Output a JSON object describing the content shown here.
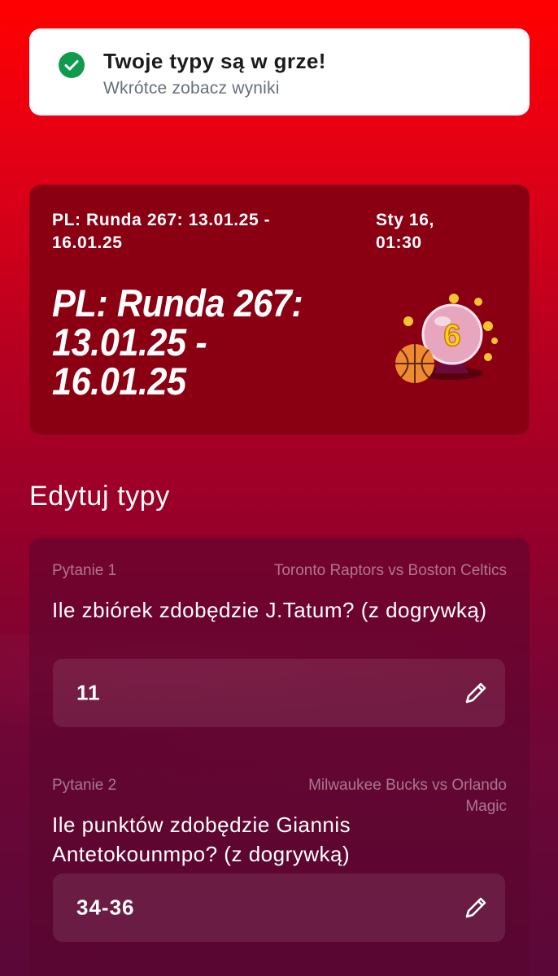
{
  "toast": {
    "icon": "check-circle-icon",
    "title": "Twoje typy są w grze!",
    "subtitle": "Wkrótce zobacz wyniki"
  },
  "round": {
    "name_small": "PL: Runda 267: 13.01.25 - 16.01.25",
    "date": "Sty 16, 01:30",
    "name_big": "PL: Runda 267: 13.01.25 - 16.01.25",
    "illustration": "crystal-ball-basketball-icon",
    "illustration_number": "6"
  },
  "section": {
    "title": "Edytuj typy"
  },
  "questions": [
    {
      "label": "Pytanie 1",
      "match": "Toronto Raptors vs Boston Celtics",
      "text": "Ile zbiórek zdobędzie J.Tatum? (z dogrywką)",
      "answer": "11",
      "edit_icon": "pencil-icon"
    },
    {
      "label": "Pytanie 2",
      "match": "Milwaukee Bucks vs Orlando Magic",
      "text": "Ile punktów zdobędzie Giannis Antetokounmpo? (z dogrywką)",
      "answer": "34-36",
      "edit_icon": "pencil-icon"
    }
  ],
  "colors": {
    "background_top": "#ff0000",
    "background_bottom": "#5a0838",
    "card": "#8a0012",
    "success": "#109a4c"
  }
}
